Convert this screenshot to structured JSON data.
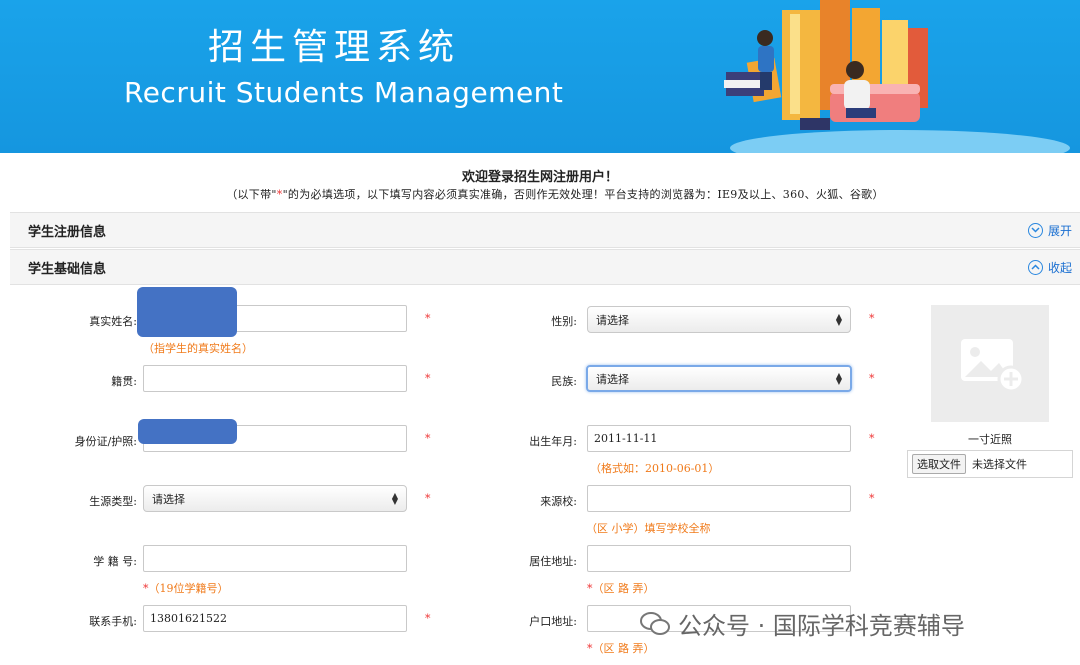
{
  "banner": {
    "title_cn": "招生管理系统",
    "title_en": "Recruit Students  Management"
  },
  "welcome": "欢迎登录招生网注册用户！",
  "notice_prefix": "（以下带\"",
  "notice_star": "*",
  "notice_suffix": "\"的为必填选项，以下填写内容必须真实准确，否则作无效处理！平台支持的浏览器为：IE9及以上、360、火狐、谷歌）",
  "panels": {
    "registration": {
      "title": "学生注册信息",
      "toggle": "展开"
    },
    "basic": {
      "title": "学生基础信息",
      "toggle": "收起"
    }
  },
  "form": {
    "name": {
      "label": "真实姓名:",
      "value": "",
      "hint": "（指学生的真实姓名）"
    },
    "gender": {
      "label": "性别:",
      "value": "请选择"
    },
    "native": {
      "label": "籍贯:",
      "value": ""
    },
    "ethnic": {
      "label": "民族:",
      "value": "请选择"
    },
    "idcard": {
      "label": "身份证/护照:",
      "value": ""
    },
    "birth": {
      "label": "出生年月:",
      "value": "2011-11-11",
      "hint": "（格式如：2010-06-01）"
    },
    "source_type": {
      "label": "生源类型:",
      "value": "请选择"
    },
    "school": {
      "label": "来源校:",
      "value": "",
      "hint": "（区 小学）填写学校全称"
    },
    "student_no": {
      "label": "学 籍 号:",
      "value": "",
      "hint": "（19位学籍号）"
    },
    "address": {
      "label": "居住地址:",
      "value": "",
      "hint": "（区 路 弄）"
    },
    "phone": {
      "label": "联系手机:",
      "value": "13801621522"
    },
    "hukou": {
      "label": "户口地址:",
      "value": "",
      "hint": "（区 路 弄）"
    },
    "required_mark": "*"
  },
  "photo": {
    "label": "一寸近照",
    "file_button": "选取文件",
    "file_status": "未选择文件"
  },
  "watermark": "公众号 · 国际学科竞赛辅导",
  "colors": {
    "banner": "#1aa3ea",
    "required": "#e33333",
    "hint": "#f07a1a",
    "link": "#1a6fd1"
  }
}
